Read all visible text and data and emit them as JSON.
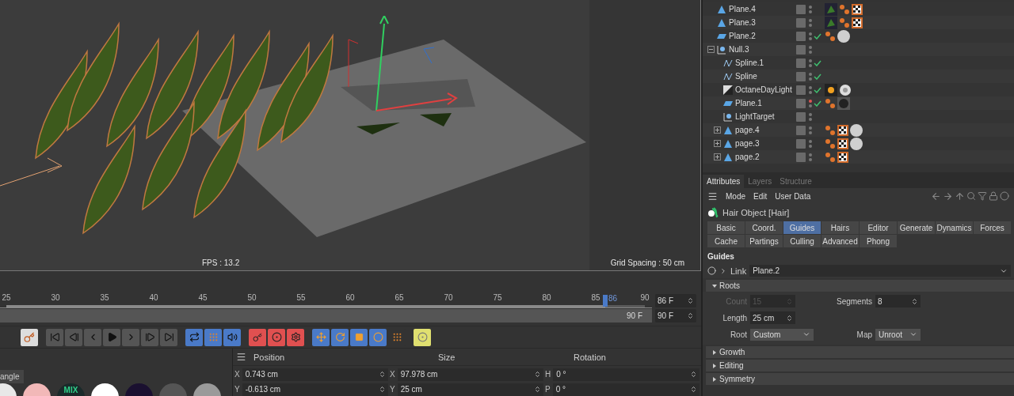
{
  "viewport": {
    "fps": "FPS : 13.2",
    "grid_spacing": "Grid Spacing : 50 cm"
  },
  "timeline": {
    "ticks": [
      "25",
      "30",
      "35",
      "40",
      "45",
      "50",
      "55",
      "60",
      "65",
      "70",
      "75",
      "80",
      "85",
      "90"
    ],
    "current_frame": "86",
    "level": 0.938,
    "frame_field": "86 F",
    "range_end": "90 F",
    "end_field": "90 F"
  },
  "objects": [
    {
      "name": "Plane.4",
      "kind": "polygon",
      "check": false,
      "editor_off": false,
      "tags": [
        {
          "kind": "texture"
        },
        {
          "kind": "phong"
        },
        {
          "kind": "checker"
        }
      ]
    },
    {
      "name": "Plane.3",
      "kind": "polygon",
      "check": false,
      "editor_off": false,
      "tags": [
        {
          "kind": "texture"
        },
        {
          "kind": "phong"
        },
        {
          "kind": "checker"
        }
      ]
    },
    {
      "name": "Plane.2",
      "kind": "plane",
      "check": true,
      "editor_off": false,
      "tags": [
        {
          "kind": "phong"
        },
        {
          "kind": "sphere"
        }
      ]
    },
    {
      "name": "Null.3",
      "kind": "null",
      "check": false,
      "editor_off": false,
      "expanded": true,
      "children": [
        {
          "name": "Spline.1",
          "kind": "spline",
          "check": true,
          "editor_off": false
        },
        {
          "name": "Spline",
          "kind": "spline",
          "check": true,
          "editor_off": false
        },
        {
          "name": "OctaneDayLight",
          "kind": "light",
          "check": true,
          "editor_off": false,
          "tags": [
            {
              "kind": "sun"
            },
            {
              "kind": "sky"
            }
          ]
        },
        {
          "name": "Plane.1",
          "kind": "plane",
          "check": true,
          "editor_off": true,
          "tags": [
            {
              "kind": "phong"
            },
            {
              "kind": "dark"
            }
          ]
        },
        {
          "name": "LightTarget",
          "kind": "null",
          "check": false,
          "editor_off": false
        },
        {
          "name": "page.4",
          "kind": "polygon",
          "check": false,
          "editor_off": false,
          "expanded": false,
          "tags": [
            {
              "kind": "phong"
            },
            {
              "kind": "checker"
            },
            {
              "kind": "sphere"
            }
          ]
        },
        {
          "name": "page.3",
          "kind": "polygon",
          "check": false,
          "editor_off": false,
          "expanded": false,
          "tags": [
            {
              "kind": "phong"
            },
            {
              "kind": "checker"
            },
            {
              "kind": "sphere"
            }
          ]
        },
        {
          "name": "page.2",
          "kind": "polygon",
          "check": false,
          "editor_off": false,
          "expanded": false,
          "tags": [
            {
              "kind": "phong"
            },
            {
              "kind": "checker"
            }
          ]
        }
      ]
    }
  ],
  "attributes": {
    "tabs": [
      {
        "label": "Attributes",
        "selected": true
      },
      {
        "label": "Layers",
        "selected": false
      },
      {
        "label": "Structure",
        "selected": false
      }
    ],
    "menu": [
      "Mode",
      "Edit",
      "User Data"
    ],
    "object_title": "Hair Object [Hair]",
    "param_tabs": [
      {
        "label": "Basic",
        "selected": false
      },
      {
        "label": "Coord.",
        "selected": false
      },
      {
        "label": "Guides",
        "selected": true
      },
      {
        "label": "Hairs",
        "selected": false
      },
      {
        "label": "Editor",
        "selected": false
      },
      {
        "label": "Generate",
        "selected": false
      },
      {
        "label": "Dynamics",
        "selected": false
      },
      {
        "label": "Forces",
        "selected": false
      },
      {
        "label": "Cache",
        "selected": false
      },
      {
        "label": "Partings",
        "selected": false
      },
      {
        "label": "Culling",
        "selected": false
      },
      {
        "label": "Advanced",
        "selected": false
      },
      {
        "label": "Phong",
        "selected": false
      }
    ],
    "section": "Guides",
    "link": {
      "label": "Link",
      "value": "Plane.2"
    },
    "groups": [
      {
        "title": "Roots",
        "expanded": true,
        "rows": [
          [
            {
              "kind": "number",
              "label": "Count",
              "value": "15",
              "disabled": true
            },
            {
              "kind": "number",
              "label": "Segments",
              "value": "8",
              "disabled": false
            }
          ],
          [
            {
              "kind": "number",
              "label": "Length",
              "value": "25 cm",
              "disabled": false
            }
          ],
          [
            {
              "kind": "select",
              "label": "Root",
              "value": "Custom",
              "disabled": false
            },
            {
              "kind": "select",
              "label": "Map",
              "value": "Unroot",
              "disabled": false
            }
          ]
        ]
      },
      {
        "title": "Growth",
        "expanded": false
      },
      {
        "title": "Editing",
        "expanded": false
      },
      {
        "title": "Symmetry",
        "expanded": false
      }
    ]
  },
  "materials": {
    "tab": "angle",
    "balls": [
      {
        "color": "#e8e8e8"
      },
      {
        "color": "#f2b8b8"
      },
      {
        "color": "#1a2a2a",
        "label": "MIX"
      },
      {
        "color": "#ffffff"
      },
      {
        "color": "#1a1030"
      },
      {
        "color": "#555555"
      },
      {
        "color": "#9a9a9a"
      }
    ]
  },
  "coordinates": {
    "headers": [
      "Position",
      "Size",
      "Rotation"
    ],
    "rows": [
      [
        {
          "axis": "X",
          "value": "0.743 cm"
        },
        {
          "axis": "X",
          "value": "97.978 cm"
        },
        {
          "axis": "H",
          "value": "0 °"
        }
      ],
      [
        {
          "axis": "Y",
          "value": "-0.613 cm"
        },
        {
          "axis": "Y",
          "value": "25 cm"
        },
        {
          "axis": "P",
          "value": "0 °"
        }
      ]
    ]
  }
}
